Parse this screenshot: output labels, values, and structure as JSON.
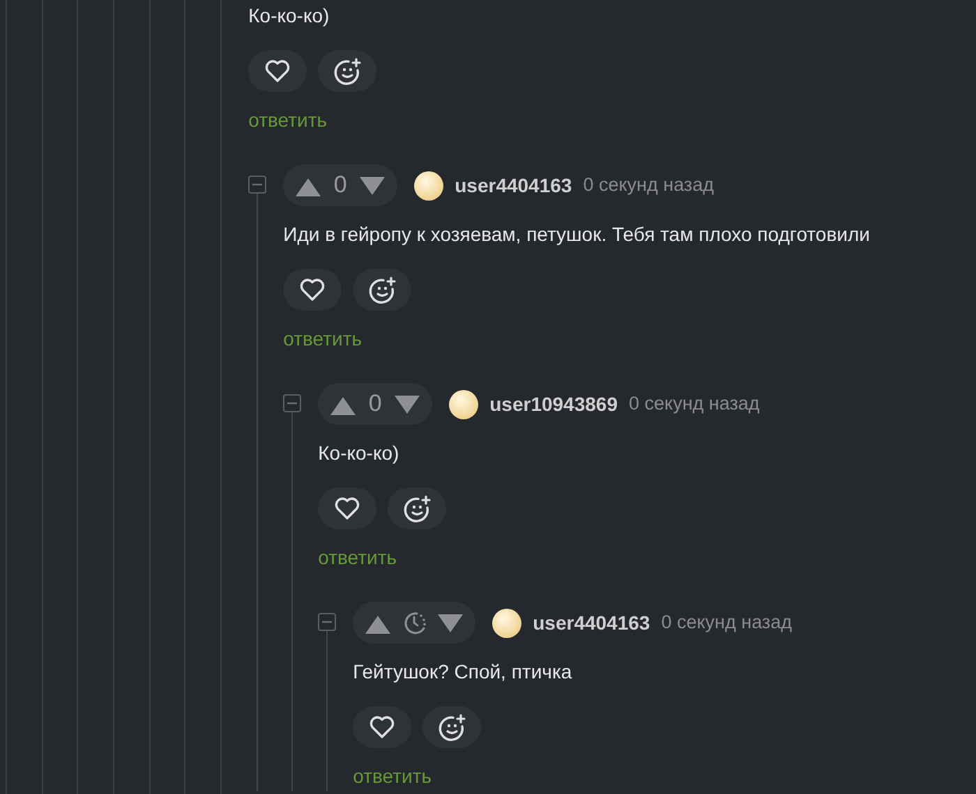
{
  "thread": {
    "text": "Ко-ко-ко)",
    "reply_label": "ответить",
    "replies": [
      {
        "username": "user4404163",
        "time": "0 секунд назад",
        "rating": {
          "kind": "score",
          "value": "0"
        },
        "text": "Иди в гейропу к хозяевам, петушок. Тебя там плохо подготовили",
        "reply_label": "ответить",
        "replies": [
          {
            "username": "user10943869",
            "time": "0 секунд назад",
            "rating": {
              "kind": "score",
              "value": "0"
            },
            "text": "Ко-ко-ко)",
            "reply_label": "ответить",
            "replies": [
              {
                "username": "user4404163",
                "time": "0 секунд назад",
                "rating": {
                  "kind": "pending"
                },
                "text": "Гейтушок? Спой, птичка",
                "reply_label": "ответить"
              }
            ]
          }
        ]
      }
    ]
  }
}
